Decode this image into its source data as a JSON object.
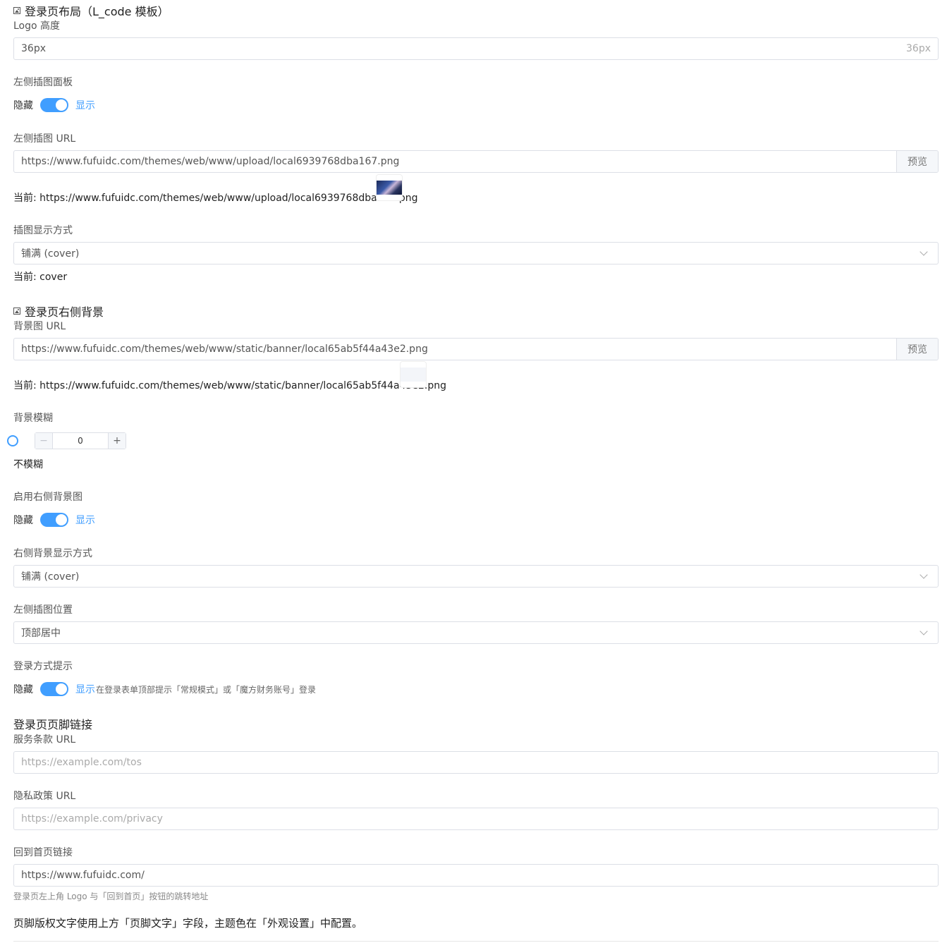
{
  "login_layout": {
    "title": "登录页布局（L_code 模板）",
    "logo_height": {
      "label": "Logo 高度",
      "value": "36px",
      "suffix": "36px"
    },
    "left_panel": {
      "label": "左侧插图面板",
      "off_text": "隐藏",
      "on_text": "显示"
    },
    "left_image_url": {
      "label": "左侧插图 URL",
      "value": "https://www.fufuidc.com/themes/web/www/upload/local6939768dba167.png",
      "preview_label": "预览",
      "current_text": "当前: https://www.fufuidc.com/themes/web/www/upload/local6939768dba167.png"
    },
    "image_display_mode": {
      "label": "插图显示方式",
      "selected": "铺满 (cover)",
      "current_text": "当前: cover"
    }
  },
  "right_background": {
    "title": "登录页右侧背景",
    "bg_url": {
      "label": "背景图 URL",
      "value": "https://www.fufuidc.com/themes/web/www/static/banner/local65ab5f44a43e2.png",
      "preview_label": "预览",
      "current_text": "当前: https://www.fufuidc.com/themes/web/www/static/banner/local65ab5f44a43e2.png"
    },
    "blur": {
      "label": "背景模糊",
      "value": "0",
      "minus": "−",
      "plus": "+",
      "status_text": "不模糊"
    },
    "enable_right_bg": {
      "label": "启用右侧背景图",
      "off_text": "隐藏",
      "on_text": "显示"
    },
    "right_bg_mode": {
      "label": "右侧背景显示方式",
      "selected": "铺满 (cover)"
    },
    "left_image_position": {
      "label": "左侧插图位置",
      "selected": "顶部居中"
    },
    "login_method_hint": {
      "label": "登录方式提示",
      "off_text": "隐藏",
      "on_text": "显示",
      "description": "在登录表单顶部提示「常规模式」或「魔方财务账号」登录"
    }
  },
  "footer_links": {
    "title": "登录页页脚链接",
    "tos": {
      "label": "服务条款 URL",
      "placeholder": "https://example.com/tos"
    },
    "privacy": {
      "label": "隐私政策 URL",
      "placeholder": "https://example.com/privacy"
    },
    "home_link": {
      "label": "回到首页链接",
      "value": "https://www.fufuidc.com/",
      "hint": "登录页左上角 Logo 与「回到首页」按钮的跳转地址"
    },
    "copyright_note": "页脚版权文字使用上方「页脚文字」字段，主题色在「外观设置」中配置。"
  },
  "colors": {
    "accent": "#409eff",
    "border": "#dcdfe6",
    "append_bg": "#f5f7fa"
  }
}
